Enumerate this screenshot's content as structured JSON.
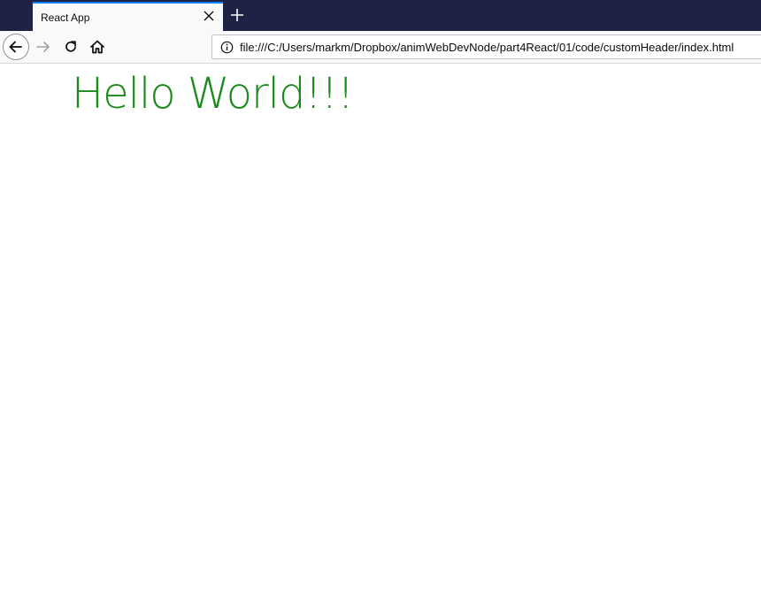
{
  "browser": {
    "tab": {
      "title": "React App"
    },
    "address_bar": {
      "url": "file:///C:/Users/markm/Dropbox/animWebDevNode/part4React/01/code/customHeader/index.html"
    },
    "icons": {
      "tab_close": "close-icon",
      "new_tab": "plus-icon",
      "back": "back-arrow-icon",
      "forward": "forward-arrow-icon",
      "reload": "reload-icon",
      "home": "home-icon",
      "site_info": "info-icon"
    },
    "colors": {
      "tabbar_bg": "#1f2244",
      "active_tab_accent": "#0a84ff",
      "toolbar_bg": "#f9f9fa"
    }
  },
  "page": {
    "heading": "Hello World!!!",
    "heading_color": "#1a8a1a"
  }
}
